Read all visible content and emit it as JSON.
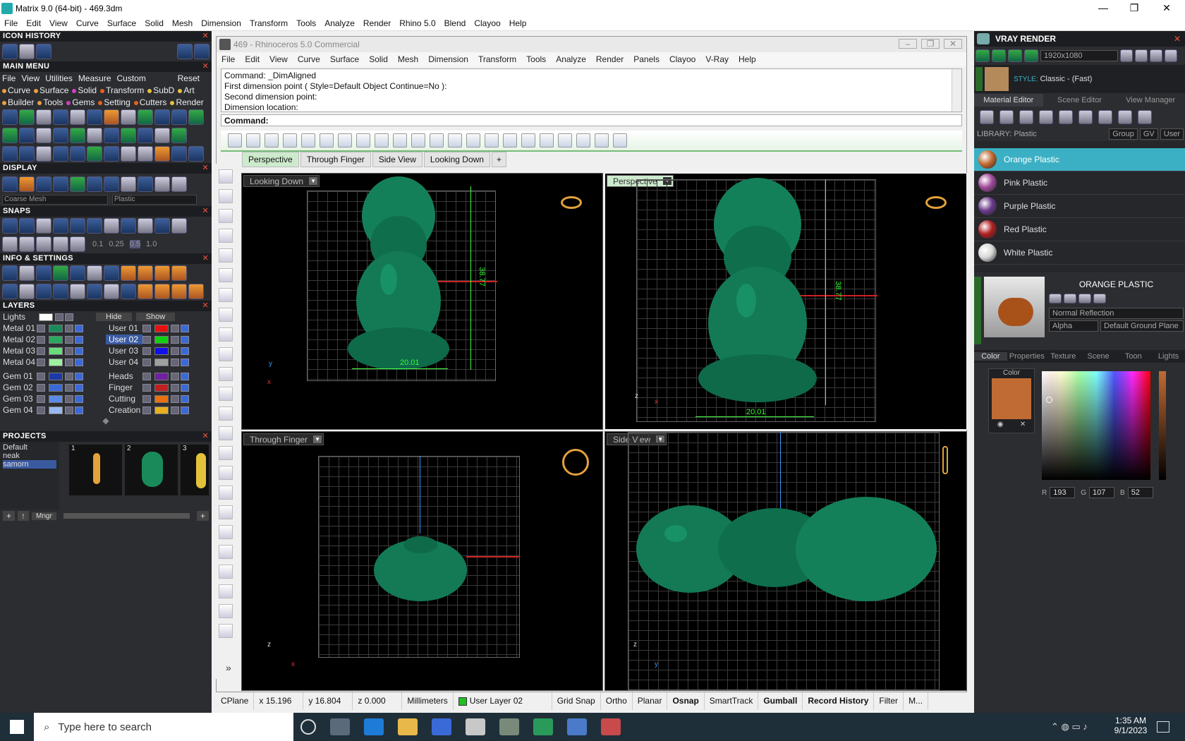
{
  "window": {
    "title": "Matrix 9.0 (64-bit) - 469.3dm",
    "minimize": "—",
    "maximize": "❐",
    "close": "✕"
  },
  "menu": [
    "File",
    "Edit",
    "View",
    "Curve",
    "Surface",
    "Solid",
    "Mesh",
    "Dimension",
    "Transform",
    "Tools",
    "Analyze",
    "Render",
    "Rhino 5.0",
    "Blend",
    "Clayoo",
    "Help"
  ],
  "left": {
    "icon_history": "ICON HISTORY",
    "main_menu": "MAIN MENU",
    "main_menu_row1": [
      "File",
      "View",
      "Utilities",
      "Measure",
      "Custom",
      "Reset"
    ],
    "main_menu_row2": [
      {
        "label": "Curve",
        "color": "#e8a040"
      },
      {
        "label": "Surface",
        "color": "#e8a040"
      },
      {
        "label": "Solid",
        "color": "#d040c0"
      },
      {
        "label": "Transform",
        "color": "#e86020"
      },
      {
        "label": "SubD",
        "color": "#e8c040"
      },
      {
        "label": "Art",
        "color": "#e8c040"
      }
    ],
    "main_menu_row3": [
      {
        "label": "Builder",
        "color": "#e8a040"
      },
      {
        "label": "Tools",
        "color": "#e8a040"
      },
      {
        "label": "Gems",
        "color": "#d040c0"
      },
      {
        "label": "Setting",
        "color": "#e86020"
      },
      {
        "label": "Cutters",
        "color": "#e86020"
      },
      {
        "label": "Render",
        "color": "#e8c040"
      }
    ],
    "display": "DISPLAY",
    "display_mesh": "Coarse Mesh",
    "display_material": "Plastic",
    "snaps": "SNAPS",
    "snap_values": [
      "0.1",
      "0.25",
      "0.5",
      "1.0"
    ],
    "info_settings": "INFO & SETTINGS",
    "layers": "LAYERS",
    "lights": "Lights",
    "hide": "Hide",
    "show": "Show",
    "layers_left": [
      {
        "name": "Metal 01",
        "color": "#1a8a5a"
      },
      {
        "name": "Metal 02",
        "color": "#2aa860"
      },
      {
        "name": "Metal 03",
        "color": "#6adc7a"
      },
      {
        "name": "Metal 04",
        "color": "#9ef0a0"
      },
      {
        "name": "Gem 01",
        "color": "#1a3aa8"
      },
      {
        "name": "Gem 02",
        "color": "#3a6ad8"
      },
      {
        "name": "Gem 03",
        "color": "#5a8ae8"
      },
      {
        "name": "Gem 04",
        "color": "#9ab8f0"
      }
    ],
    "layers_right": [
      {
        "name": "User 01",
        "color": "#e81010"
      },
      {
        "name": "User 02",
        "color": "#10d010"
      },
      {
        "name": "User 03",
        "color": "#1010e8"
      },
      {
        "name": "User 04",
        "color": "#a0a0a0"
      },
      {
        "name": "Heads",
        "color": "#7020a0"
      },
      {
        "name": "Finger",
        "color": "#c02020"
      },
      {
        "name": "Cutting",
        "color": "#e87010"
      },
      {
        "name": "Creation",
        "color": "#e8b020"
      }
    ],
    "projects": "PROJECTS",
    "project_list": [
      "Default",
      "neak",
      "samorn"
    ],
    "project_thumbs": [
      "1",
      "2",
      "3"
    ],
    "mngr": "Mngr"
  },
  "rhino": {
    "title": "469 - Rhinoceros 5.0 Commercial",
    "menu": [
      "File",
      "Edit",
      "View",
      "Curve",
      "Surface",
      "Solid",
      "Mesh",
      "Dimension",
      "Transform",
      "Tools",
      "Analyze",
      "Render",
      "Panels",
      "Clayoo",
      "V-Ray",
      "Help"
    ],
    "history": [
      "Command: _DimAligned",
      "First dimension point ( Style=Default  Object  Continue=No ):",
      "Second dimension point:",
      "Dimension location:"
    ],
    "command_label": "Command:",
    "tabs": [
      "Perspective",
      "Through Finger",
      "Side View",
      "Looking Down"
    ],
    "tab_add": "+",
    "viewports": {
      "tl": "Looking Down",
      "tr": "Perspective",
      "bl": "Through Finger",
      "br": "Side View"
    },
    "dim_width": "20.01",
    "dim_height": "38.77",
    "more_tools": "»"
  },
  "status": {
    "cplane": "CPlane",
    "x": "x 15.196",
    "y": "y 16.804",
    "z": "z 0.000",
    "units": "Millimeters",
    "layer": "User Layer 02",
    "layer_color": "#20c020",
    "toggles": [
      {
        "label": "Grid Snap",
        "bold": false
      },
      {
        "label": "Ortho",
        "bold": false
      },
      {
        "label": "Planar",
        "bold": false
      },
      {
        "label": "Osnap",
        "bold": true
      },
      {
        "label": "SmartTrack",
        "bold": false
      },
      {
        "label": "Gumball",
        "bold": true
      },
      {
        "label": "Record History",
        "bold": true
      },
      {
        "label": "Filter",
        "bold": false
      },
      {
        "label": "M...",
        "bold": false
      }
    ]
  },
  "vray": {
    "title": "VRAY RENDER",
    "resolution": "1920x1080",
    "style_label": "STYLE:",
    "style_value": "Classic - (Fast)",
    "tabs": [
      "Material Editor",
      "Scene Editor",
      "View Manager"
    ],
    "library": "LIBRARY: Plastic",
    "lib_opts": [
      "Group",
      "GV",
      "User"
    ],
    "materials": [
      {
        "name": "Orange Plastic",
        "color": "#c26b34",
        "selected": true
      },
      {
        "name": "Pink Plastic",
        "color": "#a04a9a",
        "selected": false
      },
      {
        "name": "Purple Plastic",
        "color": "#6a3a8a",
        "selected": false
      },
      {
        "name": "Red Plastic",
        "color": "#b02020",
        "selected": false
      },
      {
        "name": "White Plastic",
        "color": "#d8d8d8",
        "selected": false
      }
    ],
    "selected_name": "ORANGE PLASTIC",
    "reflection": "Normal Reflection",
    "alpha": "Alpha",
    "ground": "Default Ground Plane",
    "subtabs": [
      "Color",
      "Properties",
      "Texture",
      "Scene",
      "Toon",
      "Lights"
    ],
    "color_label": "Color",
    "swatch": "#c16b34",
    "r_label": "R",
    "r": "193",
    "g_label": "G",
    "g": "107",
    "b_label": "B",
    "b": "52"
  },
  "taskbar": {
    "search": "Type here to search",
    "time": "1:35 AM",
    "date": "9/1/2023"
  }
}
